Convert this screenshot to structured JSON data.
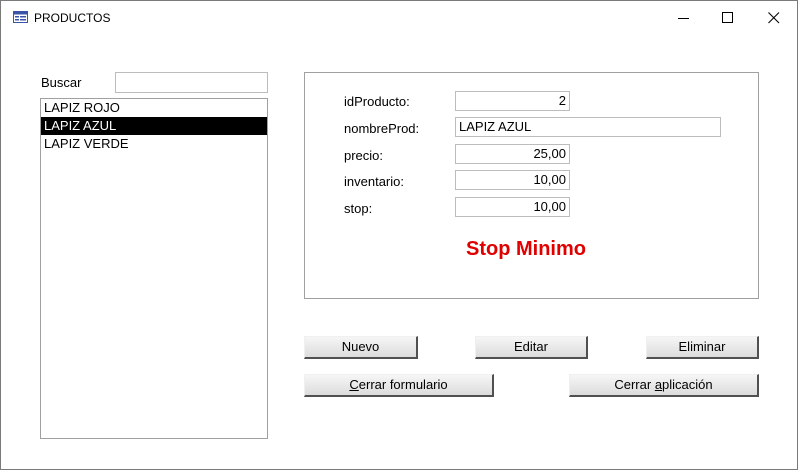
{
  "window": {
    "title": "PRODUCTOS",
    "icon": "form-icon"
  },
  "search": {
    "label": "Buscar",
    "value": ""
  },
  "product_list": {
    "items": [
      "LAPIZ ROJO",
      "LAPIZ AZUL",
      "LAPIZ VERDE"
    ],
    "selected": "LAPIZ AZUL"
  },
  "details": {
    "id_label": "idProducto:",
    "id_value": "2",
    "name_label": "nombreProd:",
    "name_value": "LAPIZ AZUL",
    "price_label": "precio:",
    "price_value": "25,00",
    "inventory_label": "inventario:",
    "inventory_value": "10,00",
    "stop_label": "stop:",
    "stop_value": "10,00"
  },
  "warning": {
    "text": "Stop Minimo",
    "color": "#e00000"
  },
  "buttons": {
    "nuevo": "Nuevo",
    "editar": "Editar",
    "eliminar": "Eliminar",
    "cerrar_formulario_pre": "",
    "cerrar_formulario_key": "C",
    "cerrar_formulario_post": "errar formulario",
    "cerrar_aplicacion_pre": "Cerrar ",
    "cerrar_aplicacion_key": "a",
    "cerrar_aplicacion_post": "plicación"
  }
}
